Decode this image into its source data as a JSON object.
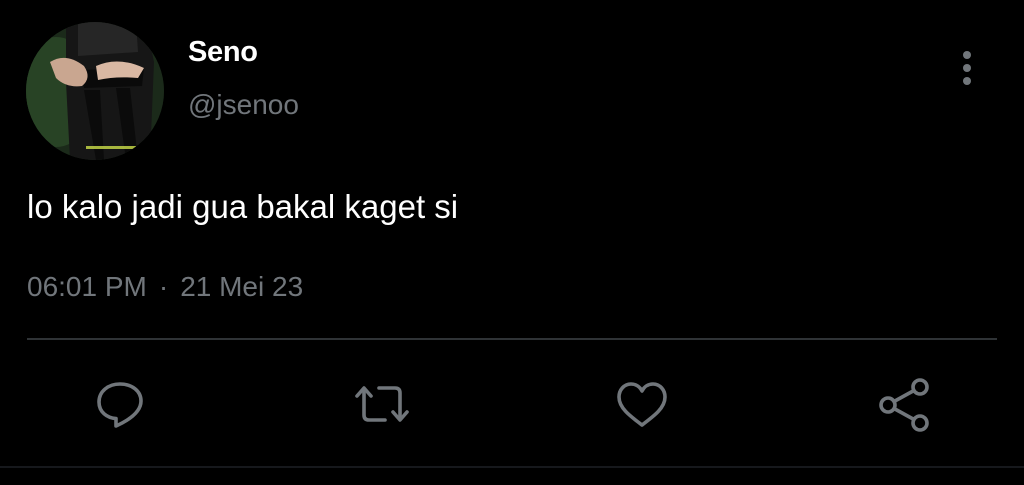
{
  "author": {
    "display_name": "Seno",
    "handle": "@jsenoo"
  },
  "tweet": {
    "text": "lo kalo jadi gua bakal kaget si",
    "time": "06:01 PM",
    "separator": "·",
    "date": "21 Mei 23"
  },
  "icons": {
    "more": "more-vertical-icon",
    "reply": "reply-icon",
    "retweet": "retweet-icon",
    "like": "heart-icon",
    "share": "share-icon"
  },
  "colors": {
    "background": "#000000",
    "primary_text": "#ffffff",
    "secondary_text": "#71767b",
    "divider": "#2f3336"
  }
}
